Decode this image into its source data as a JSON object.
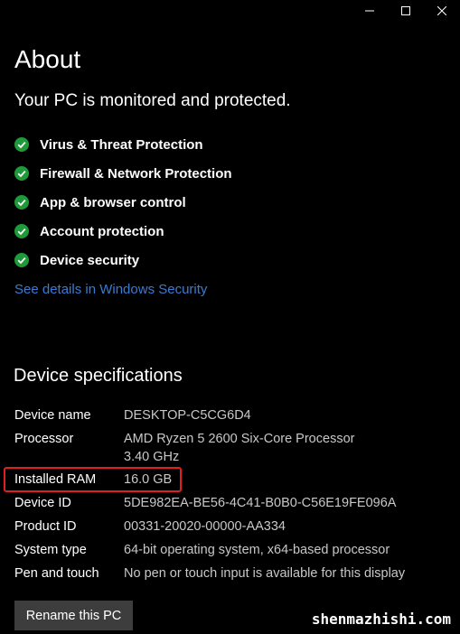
{
  "window": {
    "controls": [
      "minimize-icon",
      "maximize-icon",
      "close-icon"
    ]
  },
  "page": {
    "title": "About"
  },
  "protection": {
    "heading": "Your PC is monitored and protected.",
    "items": [
      {
        "label": "Virus & Threat Protection",
        "icon": "check-circle-icon"
      },
      {
        "label": "Firewall & Network Protection",
        "icon": "check-circle-icon"
      },
      {
        "label": "App & browser control",
        "icon": "check-circle-icon"
      },
      {
        "label": "Account protection",
        "icon": "check-circle-icon"
      },
      {
        "label": "Device security",
        "icon": "check-circle-icon"
      }
    ],
    "link": "See details in Windows Security"
  },
  "specs": {
    "heading": "Device specifications",
    "rows": [
      {
        "label": "Device name",
        "value": "DESKTOP-C5CG6D4"
      },
      {
        "label": "Processor",
        "value": "AMD Ryzen 5 2600 Six-Core Processor",
        "value2": "3.40 GHz"
      },
      {
        "label": "Installed RAM",
        "value": "16.0 GB"
      },
      {
        "label": "Device ID",
        "value": "5DE982EA-BE56-4C41-B0B0-C56E19FE096A"
      },
      {
        "label": "Product ID",
        "value": "00331-20020-00000-AA334"
      },
      {
        "label": "System type",
        "value": "64-bit operating system, x64-based processor"
      },
      {
        "label": "Pen and touch",
        "value": "No pen or touch input is available for this display"
      }
    ]
  },
  "actions": {
    "rename": "Rename this PC"
  },
  "watermark": "shenmazhishi.com",
  "colors": {
    "background": "#000000",
    "check": "#1f9a3a",
    "link": "#3a7bd5",
    "highlight": "#e02020",
    "button": "#3d3d3d"
  }
}
